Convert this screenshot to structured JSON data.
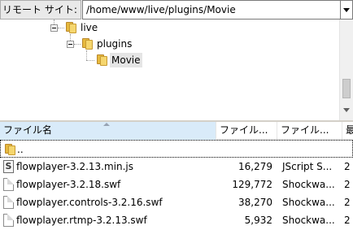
{
  "site_bar": {
    "label": "リモート サイト:",
    "path": "/home/www/live/plugins/Movie"
  },
  "tree": {
    "nodes": [
      {
        "label": "live",
        "expanded": true
      },
      {
        "label": "plugins",
        "expanded": true
      },
      {
        "label": "Movie",
        "selected": true
      }
    ]
  },
  "file_list": {
    "columns": [
      {
        "label": "ファイル名"
      },
      {
        "label": "ファイル..."
      },
      {
        "label": "ファイル..."
      },
      {
        "label": "最"
      }
    ],
    "rows": [
      {
        "name": "..",
        "size": "",
        "type": "",
        "extra": "",
        "icon": "folder-icon"
      },
      {
        "name": "flowplayer-3.2.13.min.js",
        "size": "16,279",
        "type": "JScript S...",
        "extra": "2",
        "icon": "script-file-icon"
      },
      {
        "name": "flowplayer-3.2.18.swf",
        "size": "129,772",
        "type": "Shockwa...",
        "extra": "2",
        "icon": "file-icon"
      },
      {
        "name": "flowplayer.controls-3.2.16.swf",
        "size": "38,270",
        "type": "Shockwa...",
        "extra": "2",
        "icon": "file-icon"
      },
      {
        "name": "flowplayer.rtmp-3.2.13.swf",
        "size": "5,932",
        "type": "Shockwa...",
        "extra": "2",
        "icon": "file-icon"
      }
    ]
  }
}
